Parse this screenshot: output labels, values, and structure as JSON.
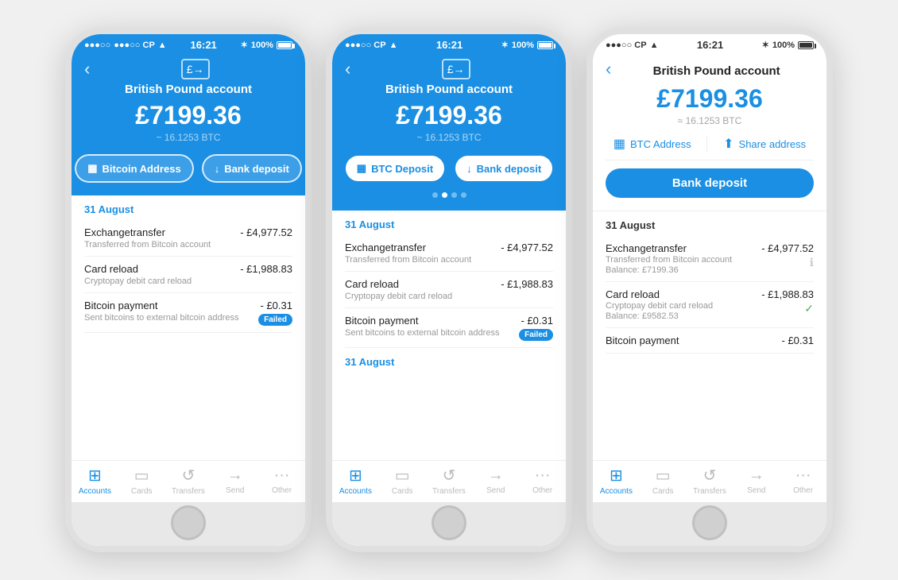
{
  "app": {
    "statusBar": {
      "left": "●●●○○ CP",
      "wifi": "WiFi",
      "time": "16:21",
      "bluetooth": "BT",
      "battery": "100%"
    }
  },
  "phone1": {
    "header": {
      "title": "British Pound account",
      "balance": "£7199.36",
      "btc": "~ 16.1253 BTC",
      "btn1": "Bitcoin Address",
      "btn2": "Bank deposit",
      "theme": "blue"
    },
    "transactions": {
      "date1": "31 August",
      "items": [
        {
          "name": "Exchangetransfer",
          "sub": "Transferred from Bitcoin account",
          "amount": "- £4,977.52"
        },
        {
          "name": "Card reload",
          "sub": "Cryptopay debit card reload",
          "amount": "- £1,988.83"
        },
        {
          "name": "Bitcoin payment",
          "sub": "Sent bitcoins to external bitcoin address",
          "amount": "- £0.31",
          "badge": "Failed"
        }
      ]
    },
    "nav": {
      "items": [
        {
          "label": "Accounts",
          "active": true,
          "icon": "layers"
        },
        {
          "label": "Cards",
          "active": false,
          "icon": "card"
        },
        {
          "label": "Transfers",
          "active": false,
          "icon": "refresh"
        },
        {
          "label": "Send",
          "active": false,
          "icon": "arrow"
        },
        {
          "label": "Other",
          "active": false,
          "icon": "dots"
        }
      ]
    }
  },
  "phone2": {
    "header": {
      "title": "British Pound account",
      "balance": "£7199.36",
      "btc": "~ 16.1253 BTC",
      "btn1": "BTC Deposit",
      "btn2": "Bank deposit",
      "theme": "blue",
      "dots": [
        false,
        true,
        false,
        false
      ]
    },
    "transactions": {
      "date1": "31 August",
      "date2": "31 August",
      "items": [
        {
          "name": "Exchangetransfer",
          "sub": "Transferred from Bitcoin account",
          "amount": "- £4,977.52"
        },
        {
          "name": "Card reload",
          "sub": "Cryptopay debit card reload",
          "amount": "- £1,988.83"
        },
        {
          "name": "Bitcoin payment",
          "sub": "Sent bitcoins to external bitcoin address",
          "amount": "- £0.31",
          "badge": "Failed"
        }
      ]
    },
    "nav": {
      "items": [
        {
          "label": "Accounts",
          "active": true
        },
        {
          "label": "Cards",
          "active": false
        },
        {
          "label": "Transfers",
          "active": false
        },
        {
          "label": "Send",
          "active": false
        },
        {
          "label": "Other",
          "active": false
        }
      ]
    }
  },
  "phone3": {
    "header": {
      "title": "British Pound account",
      "balance": "£7199.36",
      "btc": "≈ 16.1253 BTC",
      "btn1": "BTC Address",
      "btn2": "Share address",
      "btn3": "Bank deposit",
      "theme": "white"
    },
    "transactions": {
      "date1": "31 August",
      "items": [
        {
          "name": "Exchangetransfer",
          "sub": "Transferred from Bitcoin account",
          "amount": "- £4,977.52",
          "balance": "Balance: £7199.36",
          "status": "info"
        },
        {
          "name": "Card reload",
          "sub": "Cryptopay debit card reload",
          "amount": "- £1,988.83",
          "balance": "Balance: £9582.53",
          "status": "check"
        },
        {
          "name": "Bitcoin payment",
          "sub": "",
          "amount": "- £0.31"
        }
      ]
    },
    "nav": {
      "items": [
        {
          "label": "Accounts",
          "active": true
        },
        {
          "label": "Cards",
          "active": false
        },
        {
          "label": "Transfers",
          "active": false
        },
        {
          "label": "Send",
          "active": false
        },
        {
          "label": "Other",
          "active": false
        }
      ]
    }
  }
}
